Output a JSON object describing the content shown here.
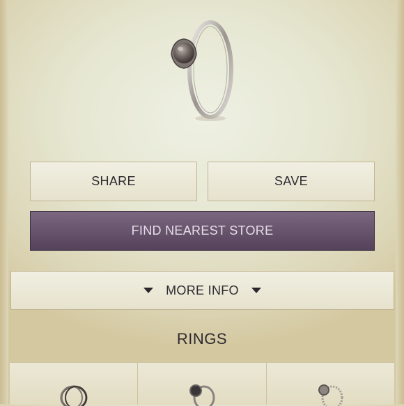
{
  "actions": {
    "share_label": "SHARE",
    "save_label": "SAVE",
    "find_store_label": "FIND NEAREST STORE",
    "more_info_label": "MORE INFO"
  },
  "section": {
    "title": "RINGS"
  },
  "thumbnails": [
    {
      "icon": "ring-icon"
    },
    {
      "icon": "ring-icon"
    },
    {
      "icon": "ring-icon"
    }
  ],
  "colors": {
    "find_store_bg": "#5f4c66",
    "button_border": "#c1b491"
  }
}
